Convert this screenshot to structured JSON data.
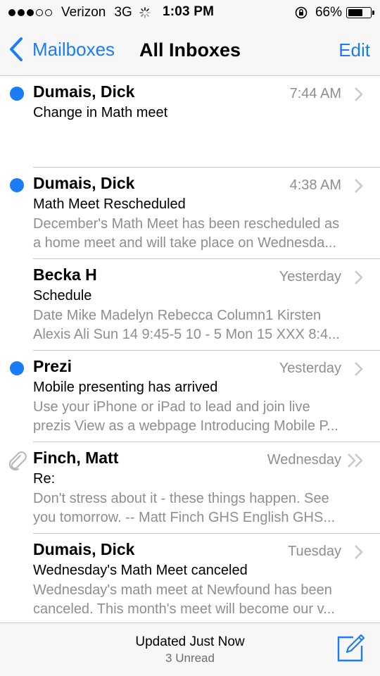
{
  "status_bar": {
    "signal_full": 3,
    "signal_empty": 2,
    "carrier": "Verizon",
    "network": "3G",
    "time": "1:03 PM",
    "battery_percent": "66%",
    "battery_level": 0.66
  },
  "nav": {
    "back_label": "Mailboxes",
    "title": "All Inboxes",
    "edit_label": "Edit"
  },
  "messages": [
    {
      "sender": "Dumais, Dick",
      "time": "7:44 AM",
      "subject": "Change in Math meet",
      "preview": [
        "",
        ""
      ],
      "unread": true,
      "attachment": false,
      "thread": false
    },
    {
      "sender": "Dumais, Dick",
      "time": "4:38 AM",
      "subject": "Math Meet Rescheduled",
      "preview": [
        "December's Math Meet has been rescheduled as",
        "a home meet and will take place on Wednesda..."
      ],
      "unread": true,
      "attachment": false,
      "thread": false
    },
    {
      "sender": "Becka H",
      "time": "Yesterday",
      "subject": "Schedule",
      "preview": [
        "Date Mike Madelyn Rebecca Column1 Kirsten",
        "Alexis Ali Sun 14 9:45-5 10 - 5 Mon 15 XXX 8:4..."
      ],
      "unread": false,
      "attachment": false,
      "thread": false
    },
    {
      "sender": "Prezi",
      "time": "Yesterday",
      "subject": "Mobile presenting has arrived",
      "preview": [
        "Use your iPhone or iPad to lead and join live",
        "prezis View as a webpage Introducing Mobile P..."
      ],
      "unread": true,
      "attachment": false,
      "thread": false
    },
    {
      "sender": "Finch, Matt",
      "time": "Wednesday",
      "subject": "Re:",
      "preview": [
        "Don't stress about it - these things happen. See",
        "you tomorrow. -- Matt Finch GHS English GHS..."
      ],
      "unread": false,
      "attachment": true,
      "thread": true
    },
    {
      "sender": "Dumais, Dick",
      "time": "Tuesday",
      "subject": "Wednesday's Math Meet canceled",
      "preview": [
        "Wednesday's math meet at Newfound has been",
        "canceled. This month's meet will become our v..."
      ],
      "unread": false,
      "attachment": false,
      "thread": false
    }
  ],
  "toolbar": {
    "status": "Updated Just Now",
    "unread_count": "3 Unread",
    "compose_icon": "compose-icon"
  },
  "colors": {
    "accent": "#1a7df5",
    "secondary_text": "#8e8e93",
    "separator": "#c8c7cc",
    "bar_background": "#f7f7f7"
  }
}
